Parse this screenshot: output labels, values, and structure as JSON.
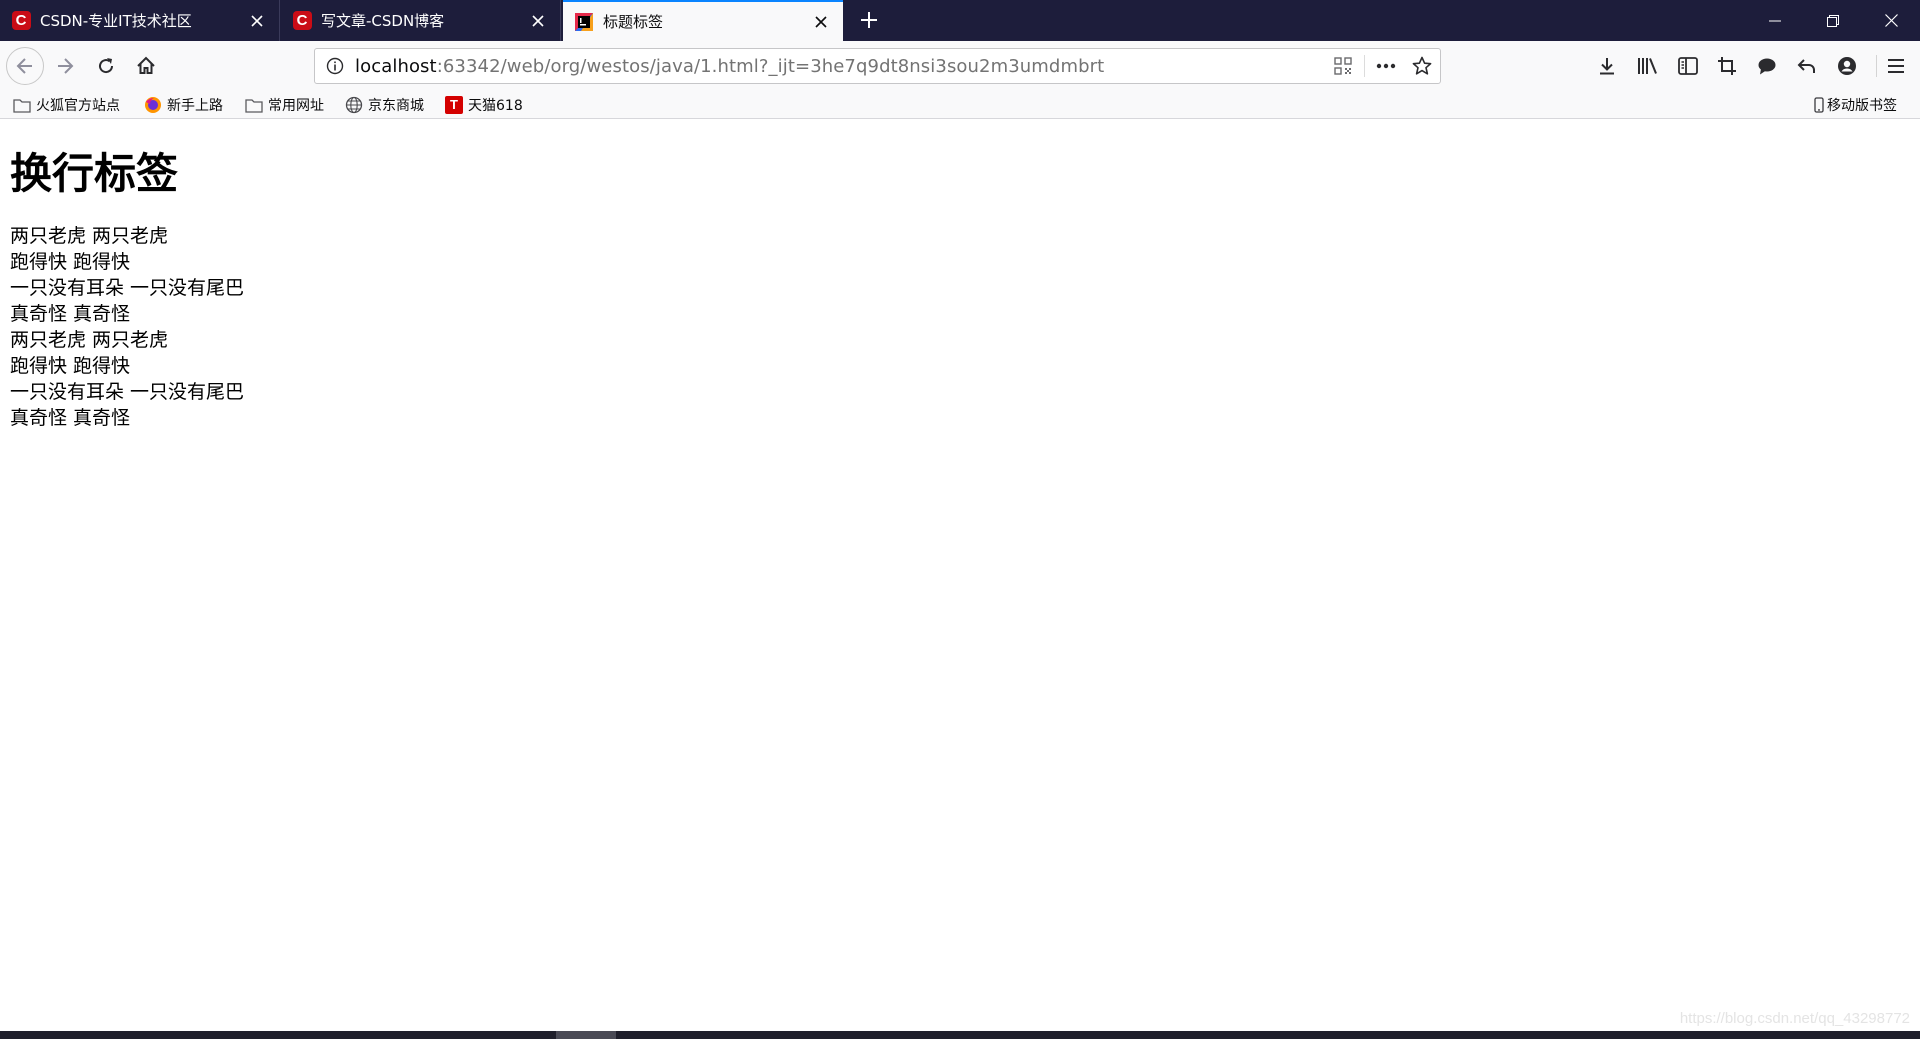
{
  "tabs": [
    {
      "title": "CSDN-专业IT技术社区",
      "favicon": "csdn-logo",
      "active": false
    },
    {
      "title": "写文章-CSDN博客",
      "favicon": "csdn-logo",
      "active": false
    },
    {
      "title": "标题标签",
      "favicon": "intellij-icon",
      "active": true
    }
  ],
  "urlbar": {
    "host": "localhost",
    "rest": ":63342/web/org/westos/java/1.html?_ijt=3he7q9dt8nsi3sou2m3umdmbrt"
  },
  "bookmarks": [
    {
      "label": "火狐官方站点",
      "icon": "folder-icon"
    },
    {
      "label": "新手上路",
      "icon": "firefox-icon"
    },
    {
      "label": "常用网址",
      "icon": "folder-icon"
    },
    {
      "label": "京东商城",
      "icon": "globe-icon"
    },
    {
      "label": "天猫618",
      "icon": "tmall-icon",
      "icon_text": "T"
    }
  ],
  "mobile_bookmarks": "移动版书签",
  "page": {
    "heading": "换行标签",
    "lines": [
      "两只老虎 两只老虎",
      "跑得快 跑得快",
      "一只没有耳朵 一只没有尾巴",
      "真奇怪 真奇怪",
      "两只老虎 两只老虎",
      "跑得快 跑得快",
      "一只没有耳朵 一只没有尾巴",
      "真奇怪 真奇怪"
    ]
  },
  "watermark": "https://blog.csdn.net/qq_43298772",
  "colors": {
    "tabstrip": "#1d1d3b",
    "active_tab_accent": "#0a84ff",
    "csdn_red": "#ca0c16",
    "tmall_red": "#d40000"
  }
}
